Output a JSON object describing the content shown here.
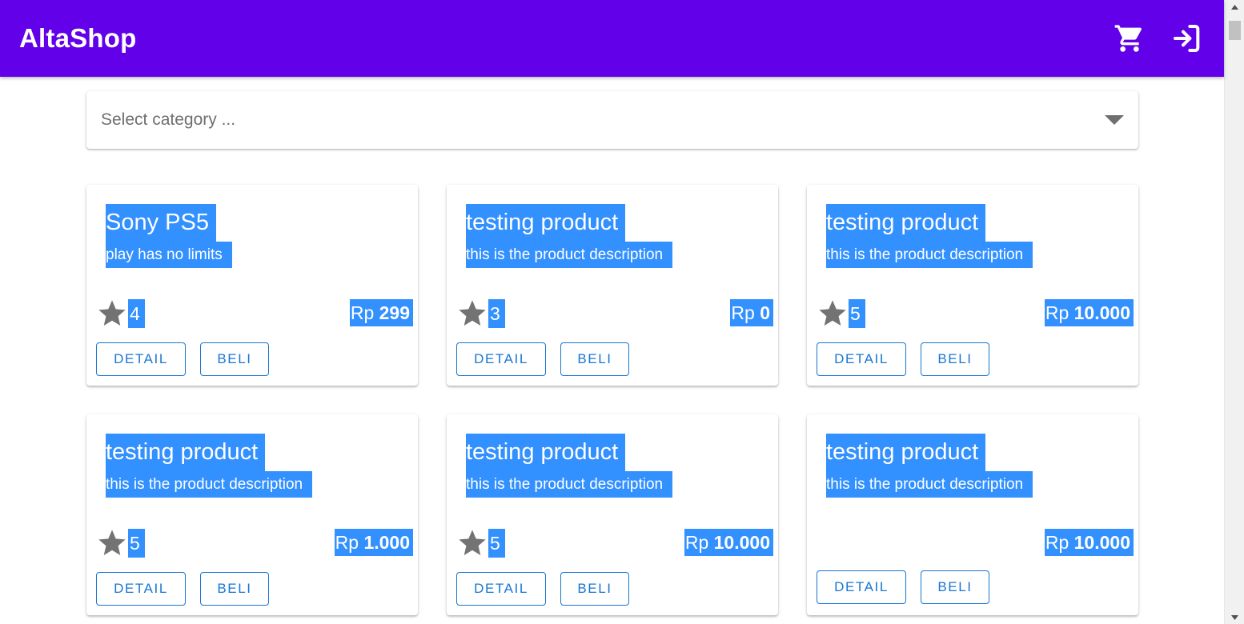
{
  "app": {
    "title": "AltaShop"
  },
  "header": {
    "icons": [
      "cart-icon",
      "login-icon"
    ]
  },
  "filter": {
    "placeholder": "Select category ..."
  },
  "colors": {
    "appbar": "#6200ea",
    "highlight": "#3390ff",
    "button": "#1976d2"
  },
  "products": [
    {
      "name": "Sony PS5",
      "description": "play has no limits",
      "rating": "4",
      "currency": "Rp",
      "price": "299",
      "detail_label": "DETAIL",
      "buy_label": "BELI"
    },
    {
      "name": "testing product",
      "description": "this is the product description",
      "rating": "3",
      "currency": "Rp",
      "price": "0",
      "detail_label": "DETAIL",
      "buy_label": "BELI"
    },
    {
      "name": "testing product",
      "description": "this is the product description",
      "rating": "5",
      "currency": "Rp",
      "price": "10.000",
      "detail_label": "DETAIL",
      "buy_label": "BELI"
    },
    {
      "name": "testing product",
      "description": "this is the product description",
      "rating": "5",
      "currency": "Rp",
      "price": "1.000",
      "detail_label": "DETAIL",
      "buy_label": "BELI"
    },
    {
      "name": "testing product",
      "description": "this is the product description",
      "rating": "5",
      "currency": "Rp",
      "price": "10.000",
      "detail_label": "DETAIL",
      "buy_label": "BELI"
    },
    {
      "name": "testing product",
      "description": "this is the product description",
      "rating": null,
      "currency": "Rp",
      "price": "10.000",
      "detail_label": "DETAIL",
      "buy_label": "BELI"
    }
  ]
}
